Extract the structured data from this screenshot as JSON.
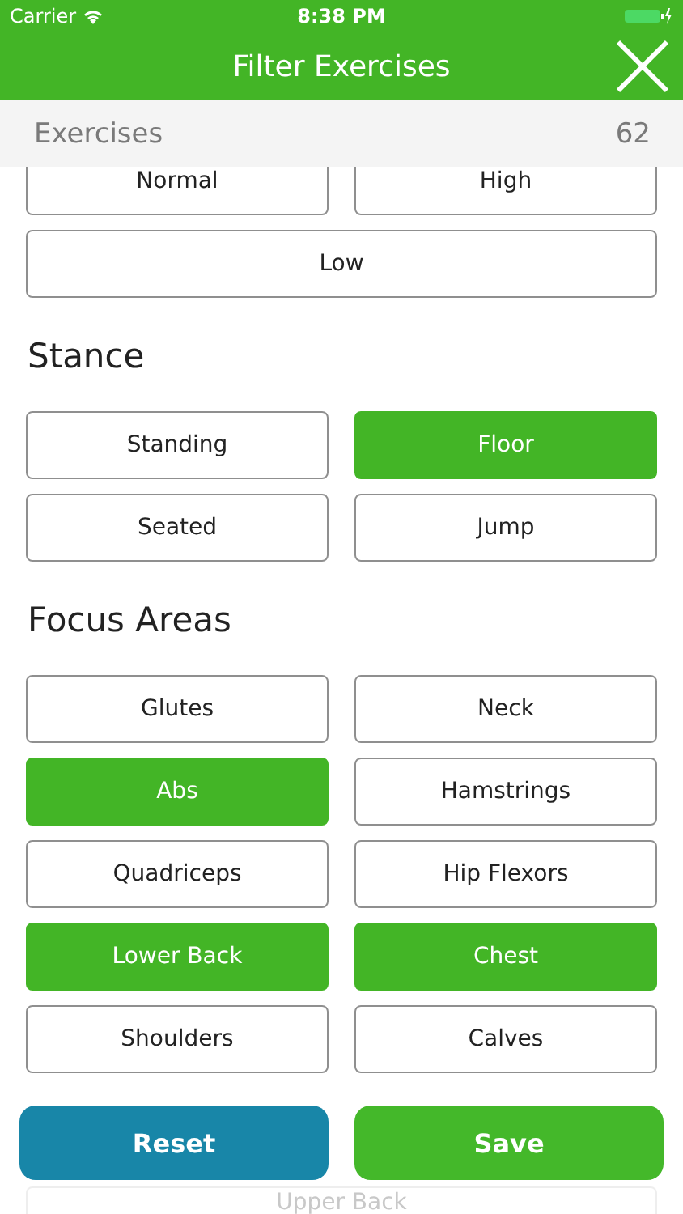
{
  "status_bar": {
    "carrier": "Carrier",
    "time": "8:38 PM"
  },
  "nav": {
    "title": "Filter Exercises"
  },
  "summary": {
    "label": "Exercises",
    "count": "62"
  },
  "sections": [
    {
      "items": [
        {
          "label": "Normal",
          "selected": false
        },
        {
          "label": "High",
          "selected": false
        },
        {
          "label": "Low",
          "selected": false,
          "wide": true
        }
      ]
    },
    {
      "title": "Stance",
      "items": [
        {
          "label": "Standing",
          "selected": false
        },
        {
          "label": "Floor",
          "selected": true
        },
        {
          "label": "Seated",
          "selected": false
        },
        {
          "label": "Jump",
          "selected": false
        }
      ]
    },
    {
      "title": "Focus Areas",
      "items": [
        {
          "label": "Glutes",
          "selected": false
        },
        {
          "label": "Neck",
          "selected": false
        },
        {
          "label": "Abs",
          "selected": true
        },
        {
          "label": "Hamstrings",
          "selected": false
        },
        {
          "label": "Quadriceps",
          "selected": false
        },
        {
          "label": "Hip Flexors",
          "selected": false
        },
        {
          "label": "Lower Back",
          "selected": true
        },
        {
          "label": "Chest",
          "selected": true
        },
        {
          "label": "Shoulders",
          "selected": false
        },
        {
          "label": "Calves",
          "selected": false
        },
        {
          "label": "Upper Back",
          "selected": false,
          "wide": true,
          "faded": true
        }
      ]
    }
  ],
  "actions": [
    {
      "label": "Reset",
      "kind": "reset"
    },
    {
      "label": "Save",
      "kind": "save"
    }
  ]
}
